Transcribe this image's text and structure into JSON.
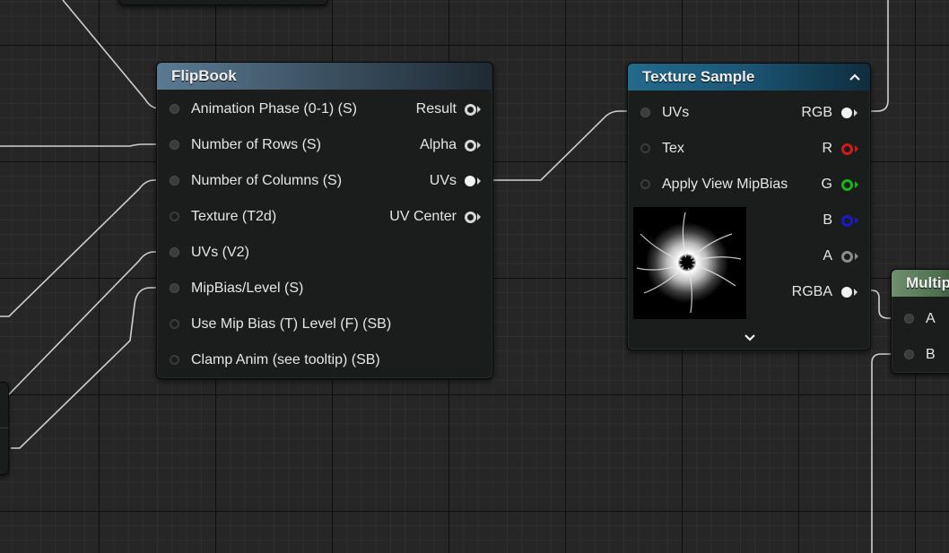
{
  "flipbook": {
    "title": "FlipBook",
    "inputs": [
      {
        "label": "Animation  Phase (0-1) (S)",
        "connected": true
      },
      {
        "label": "Number of Rows (S)",
        "connected": true
      },
      {
        "label": "Number of Columns (S)",
        "connected": true
      },
      {
        "label": "Texture (T2d)",
        "connected": false
      },
      {
        "label": "UVs (V2)",
        "connected": true
      },
      {
        "label": "MipBias/Level (S)",
        "connected": true
      },
      {
        "label": "Use Mip Bias (T) Level (F) (SB)",
        "connected": false
      },
      {
        "label": "Clamp Anim (see tooltip) (SB)",
        "connected": false
      }
    ],
    "outputs": [
      {
        "label": "Result",
        "connected": false
      },
      {
        "label": "Alpha",
        "connected": false
      },
      {
        "label": "UVs",
        "connected": true
      },
      {
        "label": "UV Center",
        "connected": false
      }
    ]
  },
  "texture_sample": {
    "title": "Texture Sample",
    "inputs": [
      {
        "label": "UVs",
        "connected": true
      },
      {
        "label": "Tex",
        "connected": false
      },
      {
        "label": "Apply View MipBias",
        "connected": false
      }
    ],
    "outputs": [
      {
        "label": "RGB",
        "color": "#e8e8e8"
      },
      {
        "label": "R",
        "color": "#d11a1a"
      },
      {
        "label": "G",
        "color": "#19b519"
      },
      {
        "label": "B",
        "color": "#1a1acc"
      },
      {
        "label": "A",
        "color": "#8c8c8c"
      },
      {
        "label": "RGBA",
        "color": "#e8e8e8"
      }
    ],
    "collapse_icon": "chevron-up-icon",
    "expand_icon": "chevron-down-icon"
  },
  "multiply": {
    "title": "Multip",
    "inputs": [
      {
        "label": "A"
      },
      {
        "label": "B"
      }
    ]
  },
  "colors": {
    "wire": "#d0d0d0",
    "canvas": "#262626"
  }
}
